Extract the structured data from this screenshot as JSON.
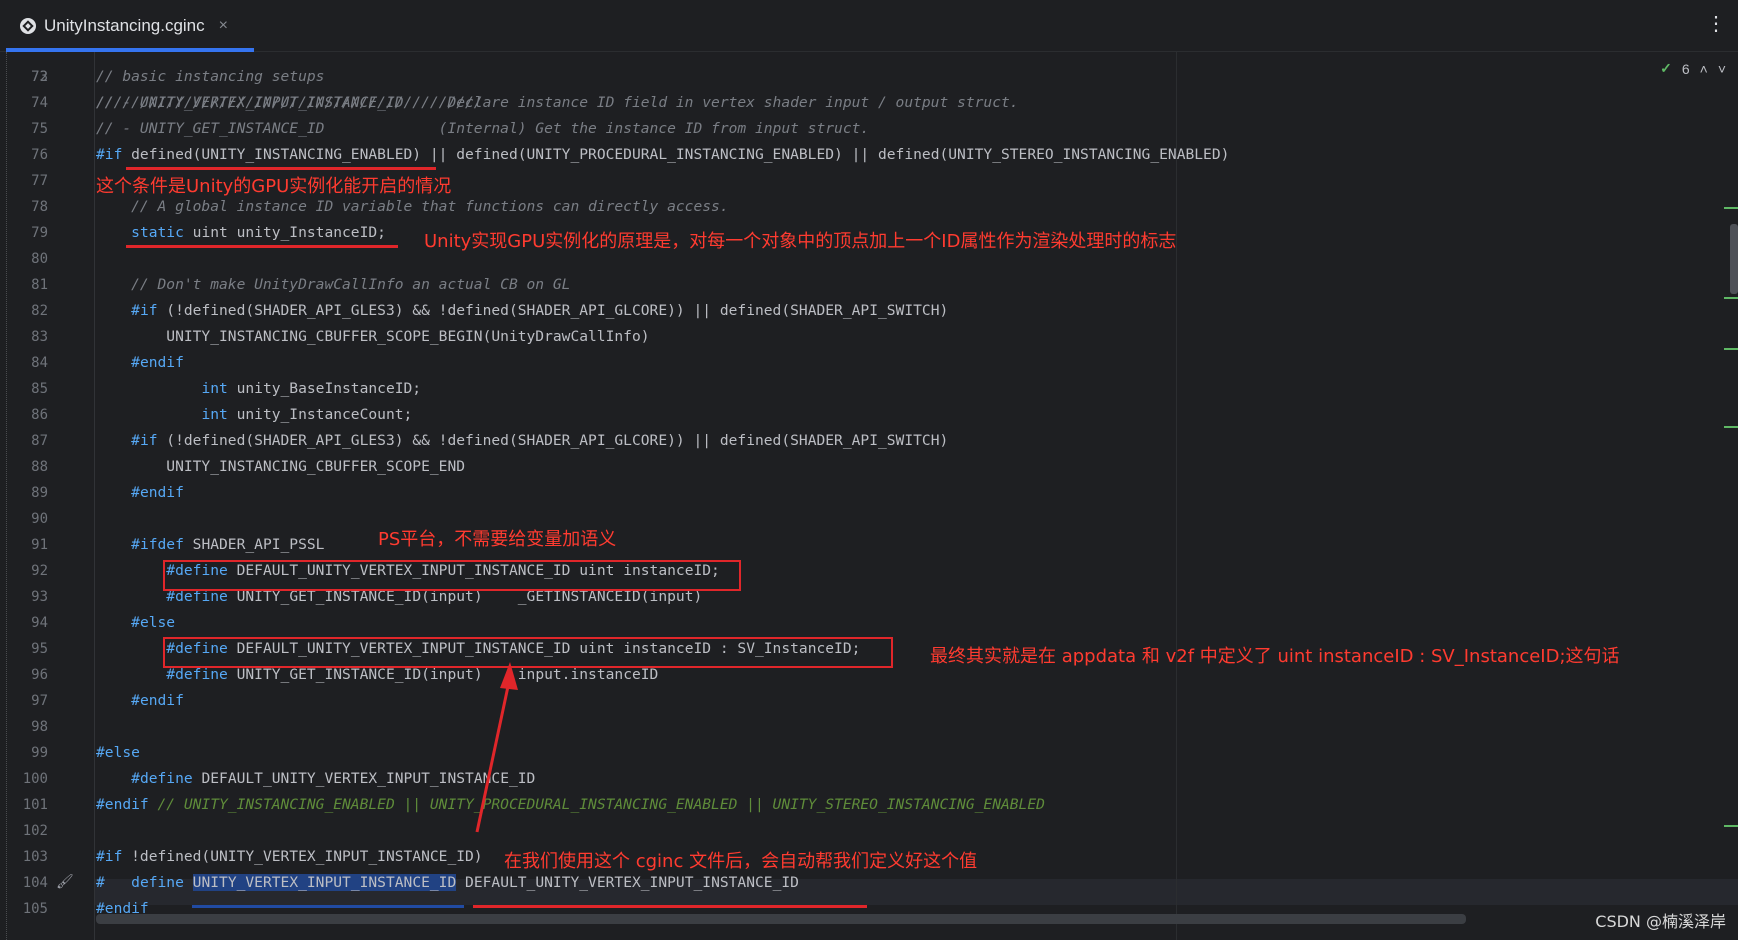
{
  "tab": {
    "title": "UnityInstancing.cginc",
    "close": "×",
    "icon": "unity-icon"
  },
  "menu": {
    "kebab": "⋮"
  },
  "inspections": {
    "count": "6",
    "prev": "˄",
    "next": "˅",
    "check": "✓"
  },
  "editor": {
    "top_partial": "////////////////////////////////////////////",
    "lines": [
      {
        "num": "73",
        "segments": [
          {
            "t": "// basic instancing setups",
            "c": "cm"
          }
        ]
      },
      {
        "num": "74",
        "segments": [
          {
            "t": "// - UNITY_VERTEX_INPUT_INSTANCE_ID     Declare instance ID field in vertex shader input / output struct.",
            "c": "cm"
          }
        ]
      },
      {
        "num": "75",
        "segments": [
          {
            "t": "// - UNITY_GET_INSTANCE_ID             (Internal) Get the instance ID from input struct.",
            "c": "cm"
          }
        ]
      },
      {
        "num": "76",
        "segments": [
          {
            "t": "#if",
            "c": "pp"
          },
          {
            "t": " defined(UNITY_INSTANCING_ENABLED) || defined(UNITY_PROCEDURAL_INSTANCING_ENABLED) || defined(UNITY_STEREO_INSTANCING_ENABLED)",
            "c": "sym"
          }
        ]
      },
      {
        "num": "77",
        "segments": []
      },
      {
        "num": "78",
        "segments": [
          {
            "t": "    // A global instance ID variable that functions can directly access.",
            "c": "cm"
          }
        ]
      },
      {
        "num": "79",
        "segments": [
          {
            "t": "    ",
            "c": "sym"
          },
          {
            "t": "static",
            "c": "pp"
          },
          {
            "t": " uint unity_InstanceID;",
            "c": "sym"
          }
        ]
      },
      {
        "num": "80",
        "segments": []
      },
      {
        "num": "81",
        "segments": [
          {
            "t": "    // Don't make UnityDrawCallInfo an actual CB on GL",
            "c": "cm"
          }
        ]
      },
      {
        "num": "82",
        "segments": [
          {
            "t": "    ",
            "c": "sym"
          },
          {
            "t": "#if",
            "c": "pp"
          },
          {
            "t": " (!defined(SHADER_API_GLES3) && !defined(SHADER_API_GLCORE)) || defined(SHADER_API_SWITCH)",
            "c": "sym"
          }
        ]
      },
      {
        "num": "83",
        "segments": [
          {
            "t": "        UNITY_INSTANCING_CBUFFER_SCOPE_BEGIN(UnityDrawCallInfo)",
            "c": "sym"
          }
        ]
      },
      {
        "num": "84",
        "segments": [
          {
            "t": "    ",
            "c": "sym"
          },
          {
            "t": "#endif",
            "c": "pp"
          }
        ]
      },
      {
        "num": "85",
        "segments": [
          {
            "t": "            ",
            "c": "sym"
          },
          {
            "t": "int",
            "c": "pp"
          },
          {
            "t": " unity_BaseInstanceID;",
            "c": "sym"
          }
        ]
      },
      {
        "num": "86",
        "segments": [
          {
            "t": "            ",
            "c": "sym"
          },
          {
            "t": "int",
            "c": "pp"
          },
          {
            "t": " unity_InstanceCount;",
            "c": "sym"
          }
        ]
      },
      {
        "num": "87",
        "segments": [
          {
            "t": "    ",
            "c": "sym"
          },
          {
            "t": "#if",
            "c": "pp"
          },
          {
            "t": " (!defined(SHADER_API_GLES3) && !defined(SHADER_API_GLCORE)) || defined(SHADER_API_SWITCH)",
            "c": "sym"
          }
        ]
      },
      {
        "num": "88",
        "segments": [
          {
            "t": "        UNITY_INSTANCING_CBUFFER_SCOPE_END",
            "c": "sym"
          }
        ]
      },
      {
        "num": "89",
        "segments": [
          {
            "t": "    ",
            "c": "sym"
          },
          {
            "t": "#endif",
            "c": "pp"
          }
        ]
      },
      {
        "num": "90",
        "segments": []
      },
      {
        "num": "91",
        "segments": [
          {
            "t": "    ",
            "c": "sym"
          },
          {
            "t": "#ifdef",
            "c": "pp"
          },
          {
            "t": " SHADER_API_PSSL",
            "c": "sym"
          }
        ]
      },
      {
        "num": "92",
        "segments": [
          {
            "t": "        ",
            "c": "sym"
          },
          {
            "t": "#define",
            "c": "pp"
          },
          {
            "t": " DEFAULT_UNITY_VERTEX_INPUT_INSTANCE_ID uint instanceID;",
            "c": "sym"
          }
        ]
      },
      {
        "num": "93",
        "segments": [
          {
            "t": "        ",
            "c": "sym"
          },
          {
            "t": "#define",
            "c": "pp"
          },
          {
            "t": " UNITY_GET_INSTANCE_ID(input)    _GETINSTANCEID(input)",
            "c": "sym"
          }
        ]
      },
      {
        "num": "94",
        "segments": [
          {
            "t": "    ",
            "c": "sym"
          },
          {
            "t": "#else",
            "c": "pp"
          }
        ]
      },
      {
        "num": "95",
        "segments": [
          {
            "t": "        ",
            "c": "sym"
          },
          {
            "t": "#define",
            "c": "pp"
          },
          {
            "t": " DEFAULT_UNITY_VERTEX_INPUT_INSTANCE_ID uint instanceID : SV_InstanceID;",
            "c": "sym"
          }
        ]
      },
      {
        "num": "96",
        "segments": [
          {
            "t": "        ",
            "c": "sym"
          },
          {
            "t": "#define",
            "c": "pp"
          },
          {
            "t": " UNITY_GET_INSTANCE_ID(input)    input.instanceID",
            "c": "sym"
          }
        ]
      },
      {
        "num": "97",
        "segments": [
          {
            "t": "    ",
            "c": "sym"
          },
          {
            "t": "#endif",
            "c": "pp"
          }
        ]
      },
      {
        "num": "98",
        "segments": []
      },
      {
        "num": "99",
        "segments": [
          {
            "t": "#else",
            "c": "pp"
          }
        ]
      },
      {
        "num": "100",
        "segments": [
          {
            "t": "    ",
            "c": "sym"
          },
          {
            "t": "#define",
            "c": "pp"
          },
          {
            "t": " DEFAULT_UNITY_VERTEX_INPUT_INSTANCE_ID",
            "c": "sym"
          }
        ]
      },
      {
        "num": "101",
        "segments": [
          {
            "t": "#endif",
            "c": "pp"
          },
          {
            "t": " // UNITY_INSTANCING_ENABLED || UNITY_PROCEDURAL_INSTANCING_ENABLED || UNITY_STEREO_INSTANCING_ENABLED",
            "c": "cmg"
          }
        ]
      },
      {
        "num": "102",
        "segments": []
      },
      {
        "num": "103",
        "segments": [
          {
            "t": "#if",
            "c": "pp"
          },
          {
            "t": " !defined(UNITY_VERTEX_INPUT_INSTANCE_ID)",
            "c": "sym"
          }
        ]
      },
      {
        "num": "104",
        "segments": [
          {
            "t": "#",
            "c": "pp"
          },
          {
            "t": "   ",
            "c": "sym"
          },
          {
            "t": "define",
            "c": "pp"
          },
          {
            "t": " ",
            "c": "sym"
          },
          {
            "t": "UNITY_VERTEX_INPUT_INSTANCE_ID",
            "c": "sym sel"
          },
          {
            "t": " DEFAULT_UNITY_VERTEX_INPUT_INSTANCE_ID",
            "c": "sym"
          }
        ]
      },
      {
        "num": "105",
        "segments": [
          {
            "t": "#endif",
            "c": "pp"
          }
        ]
      }
    ]
  },
  "annotations": {
    "a1": "这个条件是Unity的GPU实例化能开启的情况",
    "a2": "Unity实现GPU实例化的原理是，对每一个对象中的顶点加上一个ID属性作为渲染处理时的标志",
    "a3": "PS平台，不需要给变量加语义",
    "a4": "最终其实就是在 appdata 和 v2f 中定义了 uint instanceID : SV_InstanceID;这句话",
    "a5": "在我们使用这个 cginc 文件后，会自动帮我们定义好这个值"
  },
  "watermark": "CSDN @楠溪泽岸",
  "colors": {
    "annotation": "#ff3b30",
    "accent": "#3574f0",
    "keyword": "#56a8f5"
  }
}
